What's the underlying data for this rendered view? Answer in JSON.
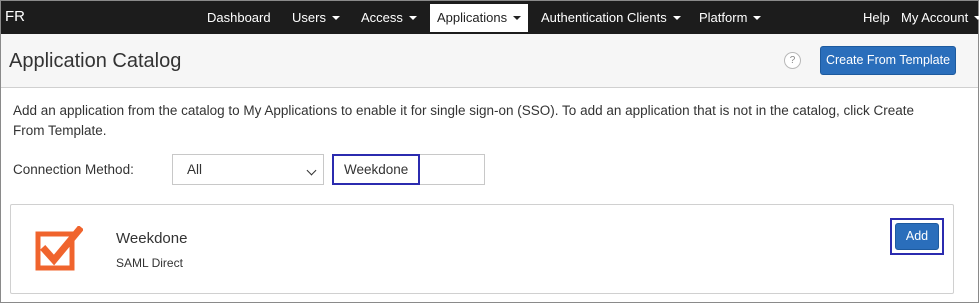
{
  "navbar": {
    "brand": "FR",
    "items": [
      {
        "label": "Dashboard",
        "dropdown": false
      },
      {
        "label": "Users",
        "dropdown": true
      },
      {
        "label": "Access",
        "dropdown": true
      },
      {
        "label": "Applications",
        "dropdown": true,
        "active": true
      },
      {
        "label": "Authentication Clients",
        "dropdown": true
      },
      {
        "label": "Platform",
        "dropdown": true
      }
    ],
    "right": {
      "help": "Help",
      "account": "My Account"
    }
  },
  "header": {
    "title": "Application Catalog",
    "help_icon": "question-mark-icon",
    "help_glyph": "?",
    "create_button": "Create From Template"
  },
  "intro": "Add an application from the catalog to My Applications to enable it for single sign-on (SSO). To add an application that is not in the catalog, click Create From Template.",
  "filter": {
    "connection_label": "Connection Method:",
    "connection_selected": "All",
    "search_value": "Weekdone"
  },
  "results": [
    {
      "name": "Weekdone",
      "method": "SAML Direct",
      "logo_icon": "weekdone-checkbox-logo",
      "add_label": "Add"
    }
  ],
  "colors": {
    "navbar_bg": "#1c1c1c",
    "primary_button": "#2a6ebb",
    "highlight_outline": "#2b2baf",
    "logo_orange": "#f0642d"
  }
}
